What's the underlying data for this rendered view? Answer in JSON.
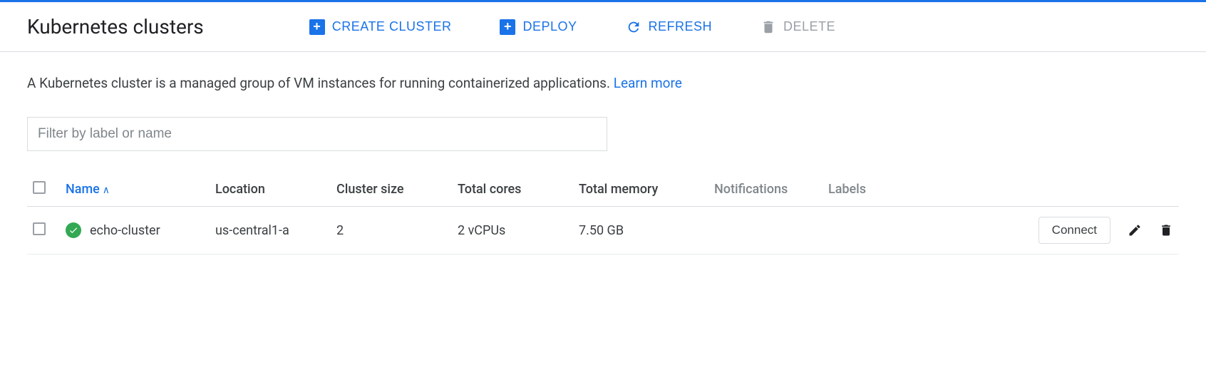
{
  "header": {
    "title": "Kubernetes clusters",
    "actions": {
      "create": "CREATE CLUSTER",
      "deploy": "DEPLOY",
      "refresh": "REFRESH",
      "delete": "DELETE"
    }
  },
  "description": {
    "text": "A Kubernetes cluster is a managed group of VM instances for running containerized applications. ",
    "link": "Learn more"
  },
  "filter": {
    "placeholder": "Filter by label or name"
  },
  "table": {
    "columns": {
      "name": "Name",
      "location": "Location",
      "size": "Cluster size",
      "cores": "Total cores",
      "memory": "Total memory",
      "notifications": "Notifications",
      "labels": "Labels"
    },
    "rows": [
      {
        "name": "echo-cluster",
        "location": "us-central1-a",
        "size": "2",
        "cores": "2 vCPUs",
        "memory": "7.50 GB",
        "notifications": "",
        "labels": "",
        "connect": "Connect"
      }
    ]
  }
}
